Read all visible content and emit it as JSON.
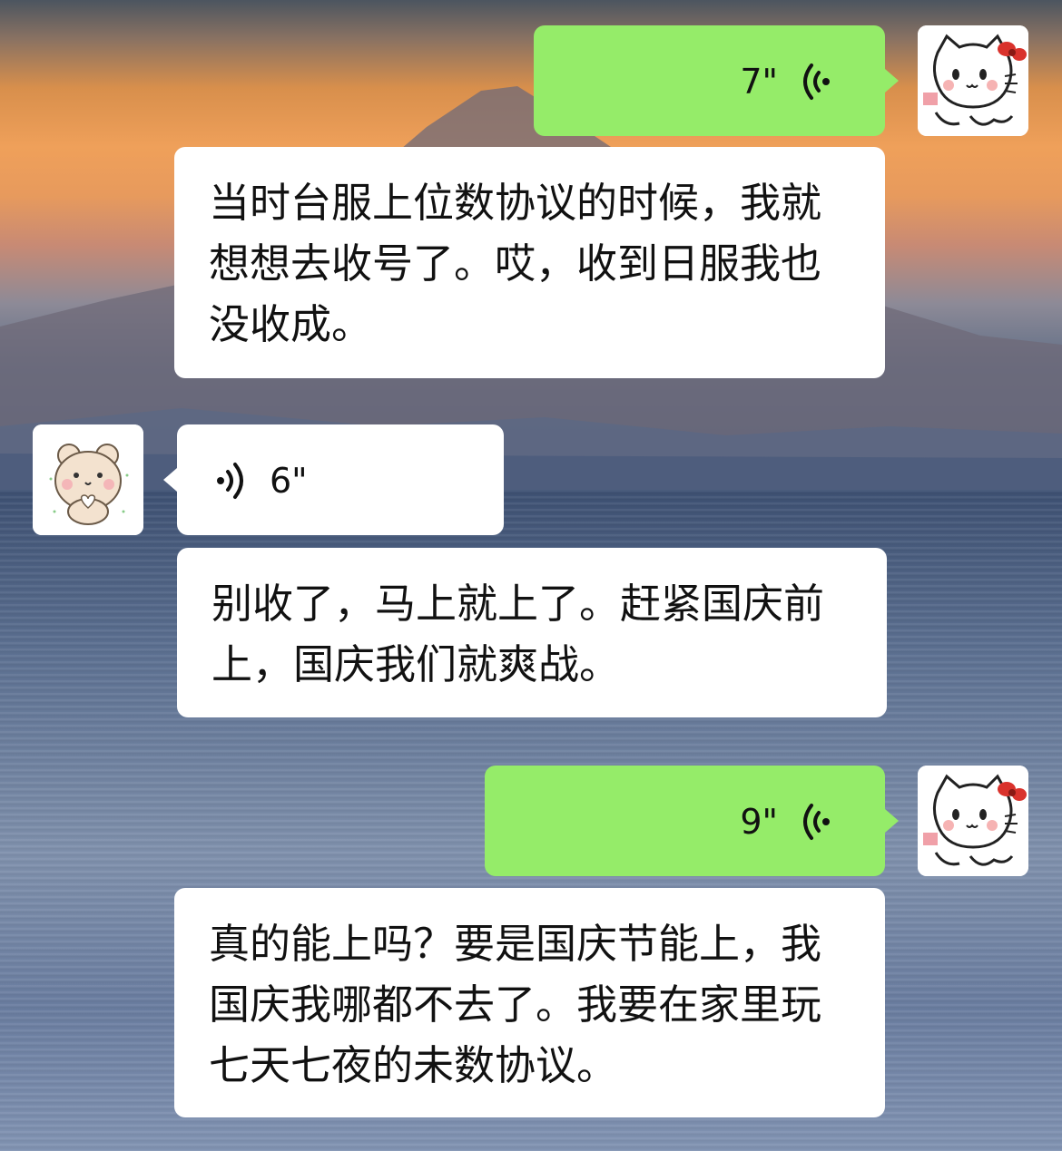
{
  "chat": {
    "messages": [
      {
        "id": "m1",
        "sender": "me",
        "type": "voice",
        "duration": "7\""
      },
      {
        "id": "m2",
        "sender": "me",
        "type": "transcript",
        "text": "当时台服上位数协议的时候，我就想想去收号了。哎，收到日服我也没收成。"
      },
      {
        "id": "m3",
        "sender": "contact",
        "type": "voice",
        "duration": "6\""
      },
      {
        "id": "m4",
        "sender": "contact",
        "type": "transcript",
        "text": "别收了，马上就上了。赶紧国庆前上，国庆我们就爽战。"
      },
      {
        "id": "m5",
        "sender": "me",
        "type": "voice",
        "duration": "9\""
      },
      {
        "id": "m6",
        "sender": "me",
        "type": "transcript",
        "text": "真的能上吗？要是国庆节能上，我国庆我哪都不去了。我要在家里玩七天七夜的未数协议。"
      }
    ]
  },
  "avatars": {
    "me": {
      "icon": "hello-kitty-cat-icon"
    },
    "contact": {
      "icon": "bear-heart-icon"
    }
  },
  "colors": {
    "outgoing_bubble": "#95ec69",
    "incoming_bubble": "#ffffff",
    "text": "#111111"
  }
}
